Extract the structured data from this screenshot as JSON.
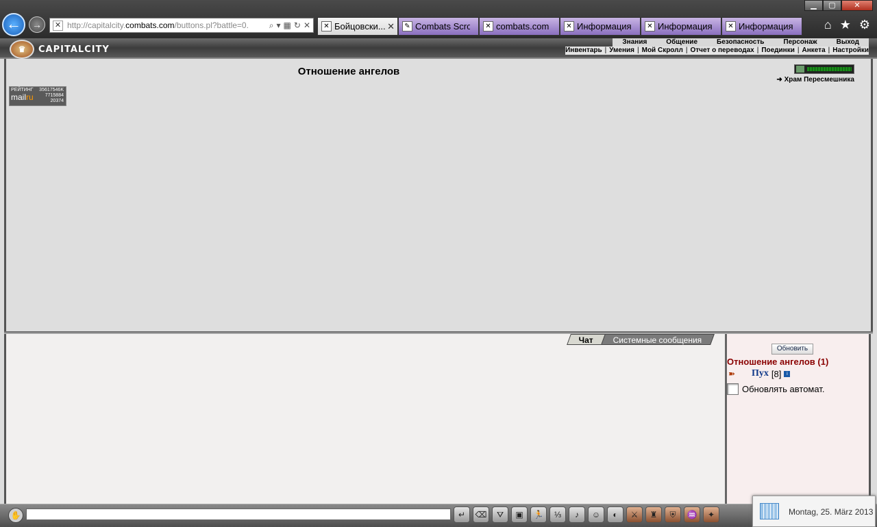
{
  "browser": {
    "window_controls": {
      "minimize": "▁",
      "maximize": "▢",
      "close": "✕"
    },
    "back_icon": "arrow-left-icon",
    "forward_icon": "arrow-right-icon",
    "address": {
      "prefix": "http://capitalcity.",
      "domain": "combats.com",
      "path": "/buttons.pl?battle=0."
    },
    "tabs": [
      {
        "label": "Бойцовски...",
        "active": true,
        "close": "✕"
      },
      {
        "label": "Combats Scroll...",
        "active": false
      },
      {
        "label": "combats.com",
        "active": false
      },
      {
        "label": "Информация ...",
        "active": false
      },
      {
        "label": "Информация ...",
        "active": false
      },
      {
        "label": "Информация ...",
        "active": false
      }
    ],
    "nav_icons": [
      "home-icon",
      "star-icon",
      "gear-icon"
    ]
  },
  "game": {
    "city_name": "CAPITALCITY",
    "top_menu": [
      "Знания",
      "Общение",
      "Безопасность",
      "Персонаж",
      "Выход"
    ],
    "sub_menu": [
      "Инвентарь",
      "Умения",
      "Мой Скролл",
      "Отчет о переводах",
      "Поединки",
      "Анкета",
      "Настройки"
    ],
    "main": {
      "title": "Отношение ангелов",
      "counter": {
        "label": "РЕЙТИНГ",
        "brand_a": "mail",
        "brand_b": "ru",
        "n1": "35617546K",
        "n2": "7715884",
        "n3": "20374"
      },
      "hp_fraction": 0.95,
      "location": "Храм Пересмешника"
    },
    "chat": {
      "tabs": [
        {
          "label": "Чат",
          "active": true
        },
        {
          "label": "Системные сообщения",
          "active": false
        }
      ]
    },
    "side": {
      "refresh": "Обновить",
      "title": "Отношение ангелов (1)",
      "player": {
        "name": "Пух",
        "level": "[8]",
        "info": "i"
      },
      "auto_refresh": "Обновлять автомат."
    },
    "bottom_tools": [
      "enter-icon",
      "eraser-icon",
      "filter-icon",
      "save-icon",
      "runner-icon",
      "translit-icon",
      "sound-icon",
      "smile-icon",
      "helmet-icon",
      "sword-icon",
      "bottle-icon",
      "shield-icon",
      "scroll-icon",
      "bag-icon"
    ]
  },
  "taskbar": {
    "date": "Montag, 25. März 2013"
  }
}
